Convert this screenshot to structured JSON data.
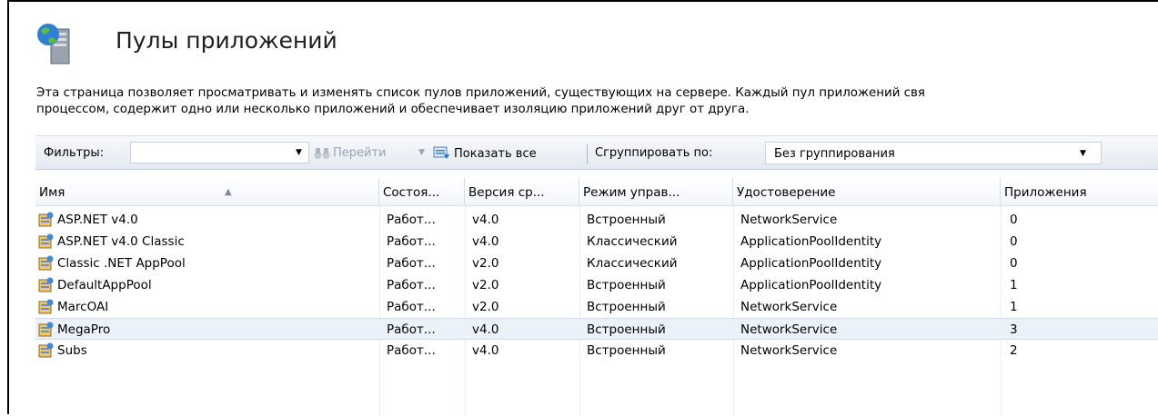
{
  "header": {
    "title": "Пулы приложений",
    "icon": "server-globe-icon"
  },
  "description": {
    "line1": "Эта страница позволяет просматривать и изменять список пулов приложений, существующих на сервере. Каждый пул приложений свя",
    "line2": "процессом, содержит одно или несколько приложений и обеспечивает изоляцию приложений друг от друга."
  },
  "toolbar": {
    "filter_label": "Фильтры:",
    "filter_value": "",
    "go_label": "Перейти",
    "show_all_label": "Показать все",
    "group_by_label": "Сгруппировать по:",
    "group_by_value": "Без группирования"
  },
  "columns": [
    "Имя",
    "Состоя...",
    "Версия ср...",
    "Режим управ...",
    "Удостоверение",
    "Приложения"
  ],
  "rows": [
    {
      "name": "ASP.NET v4.0",
      "status": "Работ...",
      "version": "v4.0",
      "mode": "Встроенный",
      "identity": "NetworkService",
      "apps": "0"
    },
    {
      "name": "ASP.NET v4.0 Classic",
      "status": "Работ...",
      "version": "v4.0",
      "mode": "Классический",
      "identity": "ApplicationPoolIdentity",
      "apps": "0"
    },
    {
      "name": "Classic .NET AppPool",
      "status": "Работ...",
      "version": "v2.0",
      "mode": "Классический",
      "identity": "ApplicationPoolIdentity",
      "apps": "0"
    },
    {
      "name": "DefaultAppPool",
      "status": "Работ...",
      "version": "v2.0",
      "mode": "Встроенный",
      "identity": "ApplicationPoolIdentity",
      "apps": "1"
    },
    {
      "name": "MarcOAI",
      "status": "Работ...",
      "version": "v2.0",
      "mode": "Встроенный",
      "identity": "NetworkService",
      "apps": "1"
    },
    {
      "name": "MegaPro",
      "status": "Работ...",
      "version": "v4.0",
      "mode": "Встроенный",
      "identity": "NetworkService",
      "apps": "3"
    },
    {
      "name": "Subs",
      "status": "Работ...",
      "version": "v4.0",
      "mode": "Встроенный",
      "identity": "NetworkService",
      "apps": "2"
    }
  ],
  "selected_row": "MegaPro",
  "colors": {
    "accent": "#2a6fc9",
    "selection": "#ebf2fa",
    "toolbar": "#e4eaf2"
  }
}
